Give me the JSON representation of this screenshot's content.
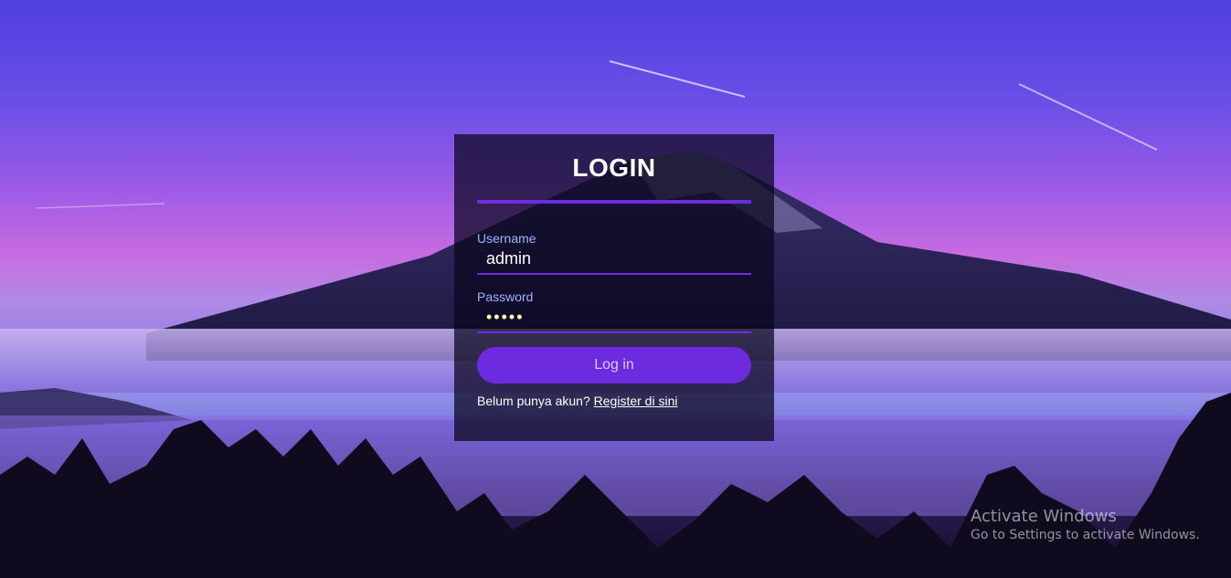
{
  "login": {
    "title": "LOGIN",
    "username_label": "Username",
    "username_value": "admin",
    "password_label": "Password",
    "password_value": "admin",
    "submit_label": "Log in",
    "register_prompt": "Belum punya akun?",
    "register_link": "Register di sini"
  },
  "watermark": {
    "title": "Activate Windows",
    "subtitle": "Go to Settings to activate Windows."
  },
  "colors": {
    "accent": "#6d2be0",
    "label": "#9fb4ff"
  }
}
